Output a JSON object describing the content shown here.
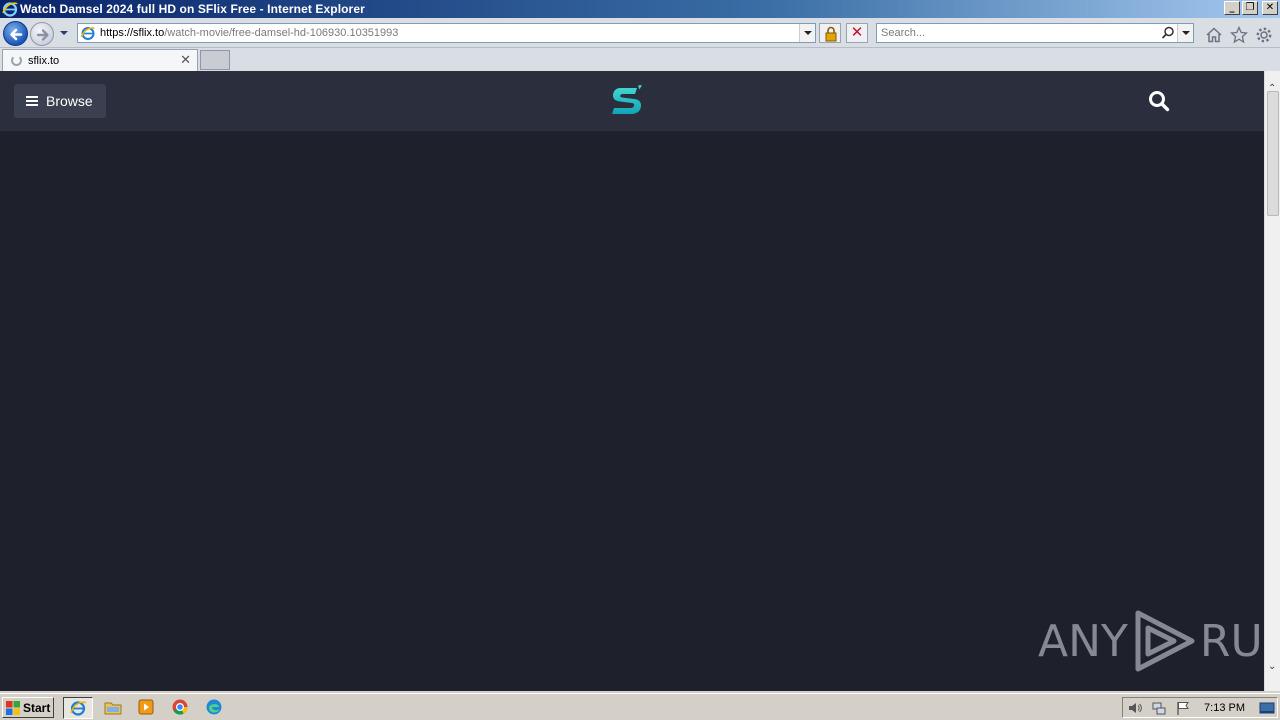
{
  "window": {
    "title": "Watch Damsel 2024 full HD on SFlix Free - Internet Explorer",
    "buttons": {
      "minimize": "_",
      "maximize": "❐",
      "close": "✕"
    }
  },
  "navbar": {
    "address_host": "https://sflix.to",
    "address_path": "/watch-movie/free-damsel-hd-106930.10351993",
    "search_placeholder": "Search...",
    "stop_glyph": "✕"
  },
  "tabs": [
    {
      "label": "sflix.to",
      "close": "✕"
    }
  ],
  "site": {
    "browse_label": "Browse"
  },
  "watermark": {
    "left": "ANY",
    "right": "RUN"
  },
  "scrollbar": {
    "up": "⌃",
    "down": "⌄"
  },
  "taskbar": {
    "start_label": "Start",
    "clock": "7:13 PM"
  },
  "colors": {
    "site_bg": "#1e202b",
    "site_header": "#2b2f3d",
    "logo_accent": "#1fb6c1"
  }
}
